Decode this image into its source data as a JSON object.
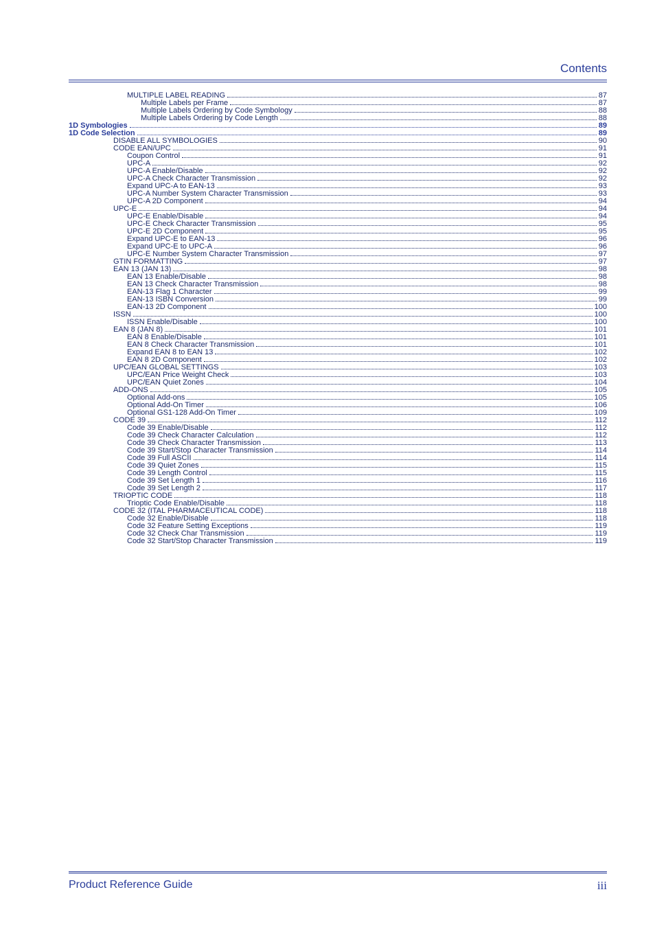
{
  "header_title": "Contents",
  "footer_left": "Product Reference Guide",
  "footer_right": "iii",
  "toc": [
    {
      "level": 2,
      "label": "MULTIPLE LABEL READING",
      "page": "87"
    },
    {
      "level": 3,
      "label": "Multiple Labels per Frame",
      "page": "87"
    },
    {
      "level": 3,
      "label": "Multiple Labels Ordering by Code Symbology",
      "page": "88"
    },
    {
      "level": 3,
      "label": "Multiple Labels Ordering by Code Length",
      "page": "88"
    },
    {
      "level": 0,
      "label": "1D Symbologies",
      "page": "89",
      "section": true
    },
    {
      "level": 0,
      "label": "1D Code Selection",
      "page": "89",
      "section": true
    },
    {
      "level": 1,
      "label": "DISABLE ALL SYMBOLOGIES",
      "page": "90"
    },
    {
      "level": 1,
      "label": "CODE EAN/UPC",
      "page": "91"
    },
    {
      "level": 2,
      "label": "Coupon Control",
      "page": "91"
    },
    {
      "level": 2,
      "label": "UPC-A",
      "page": "92"
    },
    {
      "level": 2,
      "label": "UPC-A Enable/Disable",
      "page": "92"
    },
    {
      "level": 2,
      "label": "UPC-A Check Character Transmission",
      "page": "92"
    },
    {
      "level": 2,
      "label": "Expand UPC-A to EAN-13",
      "page": "93"
    },
    {
      "level": 2,
      "label": "UPC-A Number System Character Transmission",
      "page": "93"
    },
    {
      "level": 2,
      "label": "UPC-A 2D Component",
      "page": "94"
    },
    {
      "level": 1,
      "label": "UPC-E",
      "page": "94"
    },
    {
      "level": 2,
      "label": "UPC-E Enable/Disable",
      "page": "94"
    },
    {
      "level": 2,
      "label": "UPC-E Check Character Transmission",
      "page": "95"
    },
    {
      "level": 2,
      "label": "UPC-E 2D Component",
      "page": "95"
    },
    {
      "level": 2,
      "label": "Expand UPC-E to EAN-13",
      "page": "96"
    },
    {
      "level": 2,
      "label": "Expand UPC-E to UPC-A",
      "page": "96"
    },
    {
      "level": 2,
      "label": "UPC-E Number System Character Transmission",
      "page": "97"
    },
    {
      "level": 1,
      "label": "GTIN FORMATTING",
      "page": "97"
    },
    {
      "level": 1,
      "label": "EAN 13 (JAN 13)",
      "page": "98"
    },
    {
      "level": 2,
      "label": "EAN 13 Enable/Disable",
      "page": "98"
    },
    {
      "level": 2,
      "label": "EAN 13 Check Character Transmission",
      "page": "98"
    },
    {
      "level": 2,
      "label": "EAN-13 Flag 1 Character",
      "page": "99"
    },
    {
      "level": 2,
      "label": "EAN-13 ISBN Conversion",
      "page": "99"
    },
    {
      "level": 2,
      "label": "EAN-13 2D Component",
      "page": "100"
    },
    {
      "level": 1,
      "label": "ISSN",
      "page": "100"
    },
    {
      "level": 2,
      "label": "ISSN Enable/Disable",
      "page": "100"
    },
    {
      "level": 1,
      "label": "EAN 8 (JAN 8)",
      "page": "101"
    },
    {
      "level": 2,
      "label": "EAN 8 Enable/Disable",
      "page": "101"
    },
    {
      "level": 2,
      "label": "EAN 8 Check Character Transmission",
      "page": "101"
    },
    {
      "level": 2,
      "label": "Expand EAN 8 to EAN 13",
      "page": "102"
    },
    {
      "level": 2,
      "label": "EAN 8 2D Component",
      "page": "102"
    },
    {
      "level": 1,
      "label": "UPC/EAN GLOBAL SETTINGS",
      "page": "103"
    },
    {
      "level": 2,
      "label": "UPC/EAN Price Weight Check",
      "page": "103"
    },
    {
      "level": 2,
      "label": "UPC/EAN Quiet Zones",
      "page": "104"
    },
    {
      "level": 1,
      "label": "ADD-ONS",
      "page": "105"
    },
    {
      "level": 2,
      "label": "Optional Add-ons",
      "page": "105"
    },
    {
      "level": 2,
      "label": "Optional Add-On Timer",
      "page": "106"
    },
    {
      "level": 2,
      "label": "Optional GS1-128 Add-On Timer",
      "page": "109"
    },
    {
      "level": 1,
      "label": "CODE 39",
      "page": "112"
    },
    {
      "level": 2,
      "label": "Code 39 Enable/Disable",
      "page": "112"
    },
    {
      "level": 2,
      "label": "Code 39 Check Character Calculation",
      "page": "112"
    },
    {
      "level": 2,
      "label": "Code 39 Check Character Transmission",
      "page": "113"
    },
    {
      "level": 2,
      "label": "Code 39 Start/Stop Character Transmission",
      "page": "114"
    },
    {
      "level": 2,
      "label": "Code 39 Full ASCII",
      "page": "114"
    },
    {
      "level": 2,
      "label": "Code 39 Quiet Zones",
      "page": "115"
    },
    {
      "level": 2,
      "label": "Code 39 Length Control",
      "page": "115"
    },
    {
      "level": 2,
      "label": "Code 39 Set Length 1",
      "page": "116"
    },
    {
      "level": 2,
      "label": "Code 39 Set Length 2",
      "page": "117"
    },
    {
      "level": 1,
      "label": "TRIOPTIC CODE",
      "page": "118"
    },
    {
      "level": 2,
      "label": "Trioptic Code Enable/Disable",
      "page": "118"
    },
    {
      "level": 1,
      "label": "CODE 32 (ITAL PHARMACEUTICAL CODE)",
      "page": "118"
    },
    {
      "level": 2,
      "label": "Code 32 Enable/Disable",
      "page": "118"
    },
    {
      "level": 2,
      "label": "Code 32 Feature Setting Exceptions",
      "page": "119"
    },
    {
      "level": 2,
      "label": "Code 32 Check Char Transmission",
      "page": "119"
    },
    {
      "level": 2,
      "label": "Code 32 Start/Stop Character Transmission",
      "page": "119"
    }
  ]
}
